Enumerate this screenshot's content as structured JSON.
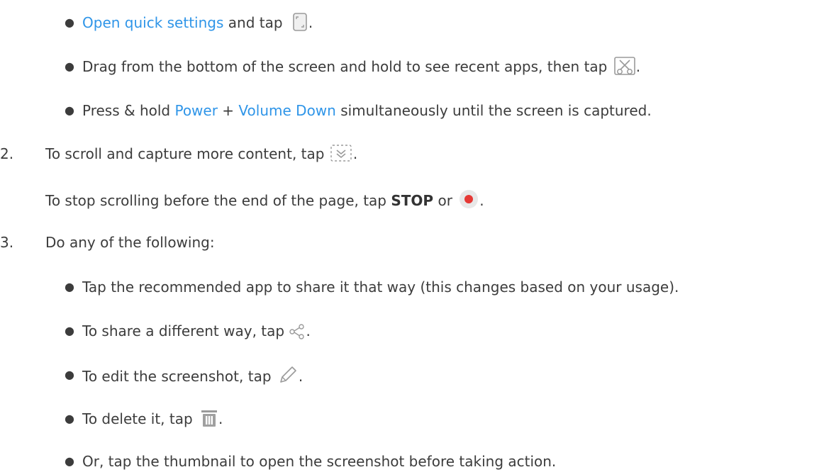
{
  "bullets_top": [
    {
      "link": "Open quick settings",
      "text": " and tap ",
      "icon": "screenshot-tile-icon",
      "after": "."
    },
    {
      "text": "Drag from the bottom of the screen and hold to see recent apps, then tap ",
      "icon": "scissors-screenshot-icon",
      "after": "."
    },
    {
      "pre": "Press & hold ",
      "link1": "Power",
      "mid": " + ",
      "link2": "Volume Down",
      "post": " simultaneously until the screen is captured."
    }
  ],
  "step2": {
    "number": "2.",
    "text": "To scroll and capture more content, tap ",
    "icon": "scroll-capture-icon",
    "after": ".",
    "sub_pre": "To stop scrolling before the end of the page, tap ",
    "sub_bold": "STOP",
    "sub_mid": " or ",
    "sub_icon": "red-record-icon",
    "sub_after": "."
  },
  "step3": {
    "number": "3.",
    "text": "Do any of the following:",
    "items": [
      {
        "text": "Tap the recommended app to share it that way (this changes based on your usage)."
      },
      {
        "text": "To share a different way, tap ",
        "icon": "share-icon",
        "after": "."
      },
      {
        "text": "To edit the screenshot, tap ",
        "icon": "pencil-icon",
        "after": "."
      },
      {
        "text": "To delete it, tap ",
        "icon": "trash-icon",
        "after": "."
      },
      {
        "text": "Or, tap the thumbnail to open the screenshot before taking action."
      }
    ]
  },
  "colors": {
    "link": "#2f95e8",
    "text": "#3c3c3c",
    "record": "#e53935"
  }
}
